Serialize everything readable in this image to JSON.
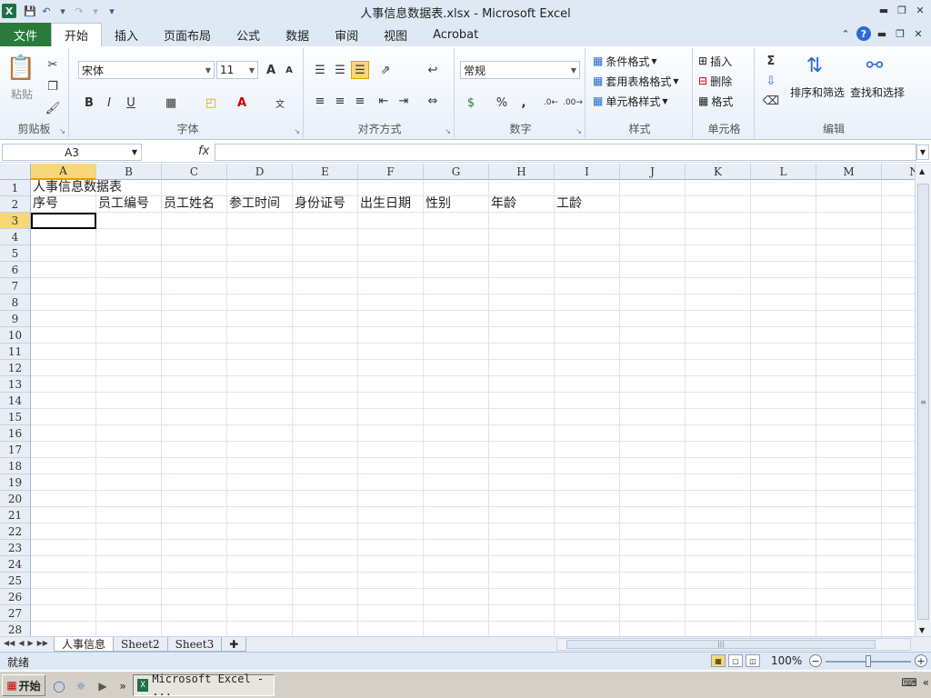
{
  "window": {
    "title": "人事信息数据表.xlsx  -  Microsoft Excel",
    "app_icon": "X"
  },
  "tabs": {
    "file": "文件",
    "items": [
      "开始",
      "插入",
      "页面布局",
      "公式",
      "数据",
      "审阅",
      "视图",
      "Acrobat"
    ]
  },
  "ribbon": {
    "clipboard": {
      "label": "剪贴板",
      "paste": "粘贴"
    },
    "font": {
      "label": "字体",
      "family": "宋体",
      "size": "11",
      "bold": "B",
      "italic": "I",
      "underline": "U",
      "grow": "A",
      "shrink": "A"
    },
    "alignment": {
      "label": "对齐方式"
    },
    "number": {
      "label": "数字",
      "format": "常规",
      "percent": "%",
      "comma": ","
    },
    "styles": {
      "label": "样式",
      "conditional": "条件格式",
      "table": "套用表格格式",
      "cell": "单元格样式"
    },
    "cells": {
      "label": "单元格",
      "insert": "插入",
      "delete": "删除",
      "format": "格式"
    },
    "editing": {
      "label": "编辑",
      "sum": "Σ",
      "sort": "排序和筛选",
      "find": "查找和选择"
    }
  },
  "formula_bar": {
    "name_box": "A3",
    "fx": "fx",
    "value": ""
  },
  "sheet": {
    "columns": [
      "A",
      "B",
      "C",
      "D",
      "E",
      "F",
      "G",
      "H",
      "I",
      "J",
      "K",
      "L",
      "M",
      "N"
    ],
    "rows": [
      "1",
      "2",
      "3",
      "4",
      "5",
      "6",
      "7",
      "8",
      "9",
      "10",
      "11",
      "12",
      "13",
      "14",
      "15",
      "16",
      "17",
      "18",
      "19",
      "20",
      "21",
      "22",
      "23",
      "24",
      "25",
      "26",
      "27",
      "28"
    ],
    "row1": [
      "人事信息数据表"
    ],
    "row2": [
      "序号",
      "员工编号",
      "员工姓名",
      "参工时间",
      "身份证号",
      "出生日期",
      "性别",
      "年龄",
      "工龄"
    ],
    "active_cell": "A3"
  },
  "sheet_tabs": [
    "人事信息",
    "Sheet2",
    "Sheet3"
  ],
  "status": {
    "text": "就绪",
    "zoom": "100%"
  },
  "taskbar": {
    "start": "开始",
    "task_label": "Microsoft Excel - ..."
  }
}
